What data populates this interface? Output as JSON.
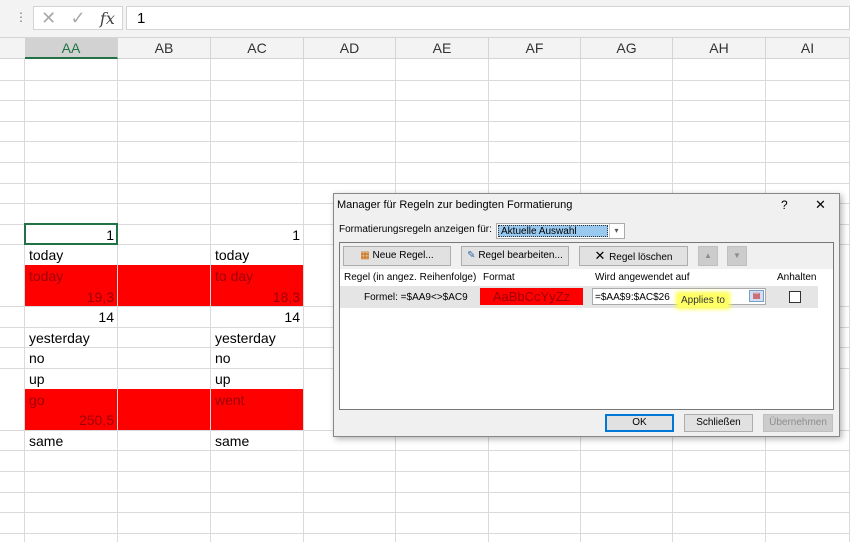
{
  "formula_bar": {
    "options_icon": "⋮",
    "cancel_icon": "✕",
    "enter_icon": "✓",
    "fx_label": "fx",
    "value": "1"
  },
  "columns": [
    "AA",
    "AB",
    "AC",
    "AD",
    "AE",
    "AF",
    "AG",
    "AH",
    "AI"
  ],
  "selected_column": "AA",
  "cells": [
    {
      "row": 8,
      "col": "AA",
      "text": "1",
      "num": true
    },
    {
      "row": 8,
      "col": "AC",
      "text": "1",
      "num": true
    },
    {
      "row": 9,
      "col": "AA",
      "text": "today"
    },
    {
      "row": 9,
      "col": "AC",
      "text": "today"
    },
    {
      "row": 10,
      "col": "AA",
      "text": "today",
      "red": true
    },
    {
      "row": 10,
      "col": "AC",
      "text": "to day",
      "red": true
    },
    {
      "row": 11,
      "col": "AA",
      "text": "19,3",
      "num": true,
      "red": true
    },
    {
      "row": 11,
      "col": "AC",
      "text": "18,3",
      "num": true,
      "red": true
    },
    {
      "row": 12,
      "col": "AA",
      "text": "14",
      "num": true
    },
    {
      "row": 12,
      "col": "AC",
      "text": "14",
      "num": true
    },
    {
      "row": 13,
      "col": "AA",
      "text": "yesterday"
    },
    {
      "row": 13,
      "col": "AC",
      "text": "yesterday"
    },
    {
      "row": 14,
      "col": "AA",
      "text": "no"
    },
    {
      "row": 14,
      "col": "AC",
      "text": "no"
    },
    {
      "row": 15,
      "col": "AA",
      "text": "up"
    },
    {
      "row": 15,
      "col": "AC",
      "text": "up"
    },
    {
      "row": 16,
      "col": "AA",
      "text": "go",
      "red": true
    },
    {
      "row": 16,
      "col": "AC",
      "text": "went",
      "red": true
    },
    {
      "row": 17,
      "col": "AA",
      "text": "250,5",
      "num": true,
      "red": true
    },
    {
      "row": 18,
      "col": "AA",
      "text": "same"
    },
    {
      "row": 18,
      "col": "AC",
      "text": "same"
    }
  ],
  "highlight_color": "#ff0000",
  "dialog": {
    "title": "Manager für Regeln zur bedingten Formatierung",
    "help": "?",
    "close": "✕",
    "show_label": "Formatierungsregeln anzeigen für:",
    "show_value": "Aktuelle Auswahl",
    "new_rule": "Neue Regel...",
    "edit_rule": "Regel bearbeiten...",
    "delete_rule": "Regel löschen",
    "headers": {
      "rule": "Regel (in angez. Reihenfolge)",
      "format": "Format",
      "applies": "Wird angewendet auf",
      "stop": "Anhalten"
    },
    "rule": {
      "formula": "Formel: =$AA9<>$AC9",
      "preview": "AaBbCcYyZz",
      "applies_to": "=$AA$9:$AC$26"
    },
    "annotation": "Applies to",
    "ok": "OK",
    "close_btn": "Schließen",
    "apply": "Übernehmen"
  }
}
